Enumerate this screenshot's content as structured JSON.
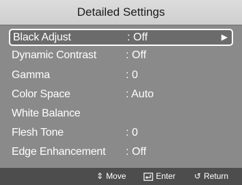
{
  "title": "Detailed Settings",
  "menu": {
    "items": [
      {
        "label": "Black Adjust",
        "value": ": Off",
        "arrow": "▶"
      },
      {
        "label": "Dynamic Contrast",
        "value": ": Off"
      },
      {
        "label": "Gamma",
        "value": ": 0"
      },
      {
        "label": "Color Space",
        "value": ": Auto"
      },
      {
        "label": "White Balance",
        "value": ""
      },
      {
        "label": "Flesh Tone",
        "value": ": 0"
      },
      {
        "label": "Edge Enhancement",
        "value": ": Off"
      }
    ]
  },
  "footer": {
    "move_icon": "⇕",
    "move_label": "Move",
    "enter_icon": "enter-icon",
    "enter_label": "Enter",
    "return_icon": "↺",
    "return_label": "Return"
  },
  "colors": {
    "background": "#8a8a8a",
    "title_bar": "#d6d6d6",
    "selection_border": "#ffffff",
    "footer": "#4d4d4d",
    "text": "#ffffff"
  }
}
